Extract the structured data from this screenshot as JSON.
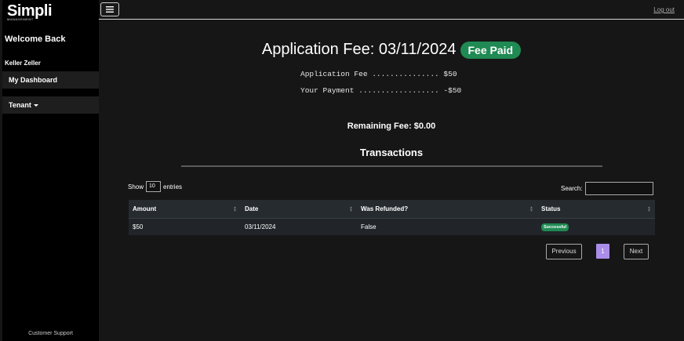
{
  "sidebar": {
    "logo_main": "Simpli",
    "logo_sub": "MANAGEMENT",
    "welcome": "Welcome Back",
    "user_name": "Keller Zeller",
    "items": [
      {
        "label": "My Dashboard"
      },
      {
        "label": "Tenant"
      }
    ],
    "support": "Customer Support"
  },
  "topbar": {
    "menu_icon": "hamburger-icon",
    "logout": "Log out"
  },
  "main": {
    "title": "Application Fee: 03/11/2024",
    "fee_status": "Fee Paid",
    "fee_line1": "Application Fee ............... $50",
    "fee_line2": "Your Payment .................. -$50",
    "remaining": "Remaining Fee: $0.00",
    "transactions_title": "Transactions"
  },
  "table_controls": {
    "show_label": "Show",
    "entries_value": "10",
    "entries_label": "entries",
    "search_label": "Search:",
    "search_value": ""
  },
  "table": {
    "headers": [
      "Amount",
      "Date",
      "Was Refunded?",
      "Status"
    ],
    "rows": [
      {
        "amount": "$50",
        "date": "03/11/2024",
        "refunded": "False",
        "status": "Successful"
      }
    ]
  },
  "pagination": {
    "prev": "Previous",
    "page": "1",
    "next": "Next"
  },
  "colors": {
    "success": "#1f8a53",
    "page_active": "#a98de8",
    "sidebar_bg": "#000000",
    "main_bg": "#161616"
  }
}
